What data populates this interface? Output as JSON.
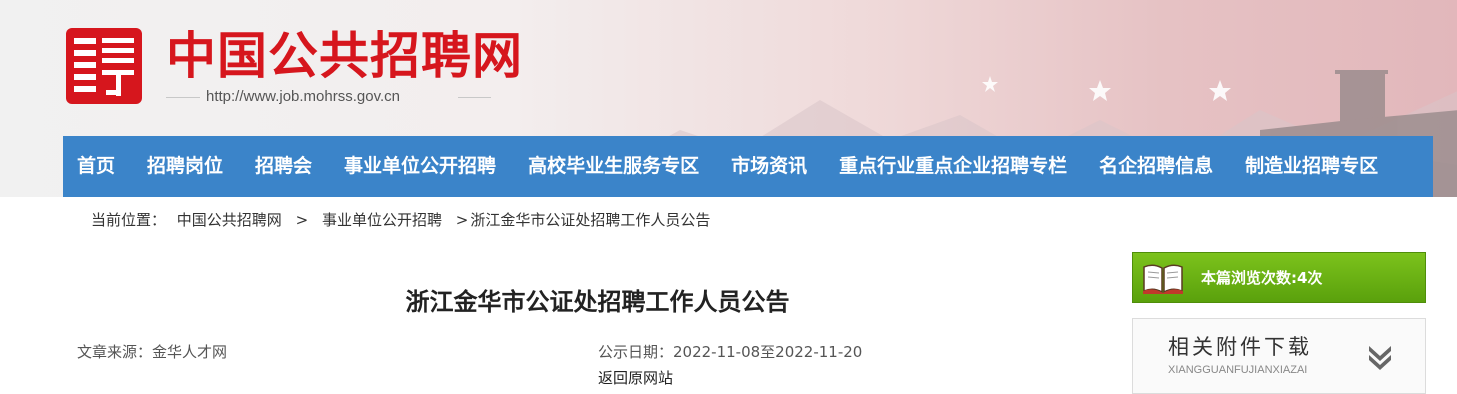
{
  "header": {
    "site_name": "中国公共招聘网",
    "site_url": "http://www.job.mohrss.gov.cn",
    "brand_color": "#d6161d"
  },
  "nav": {
    "color": "#3b84c9",
    "items": [
      "首页",
      "招聘岗位",
      "招聘会",
      "事业单位公开招聘",
      "高校毕业生服务专区",
      "市场资讯",
      "重点行业重点企业招聘专栏",
      "名企招聘信息",
      "制造业招聘专区"
    ]
  },
  "breadcrumb": {
    "prefix": "当前位置：",
    "items": [
      "中国公共招聘网",
      "事业单位公开招聘",
      "浙江金华市公证处招聘工作人员公告"
    ],
    "separator": ">"
  },
  "article": {
    "title": "浙江金华市公证处招聘工作人员公告",
    "source": "文章来源：金华人才网",
    "date": "公示日期：2022-11-08至2022-11-20",
    "back_link": "返回原网站"
  },
  "sidebar": {
    "views_text": "本篇浏览次数:4次",
    "views_color": "#6bb414",
    "attachments_title": "相关附件下载",
    "attachments_subtitle": "XIANGGUANFUJIANXIAZAI"
  }
}
